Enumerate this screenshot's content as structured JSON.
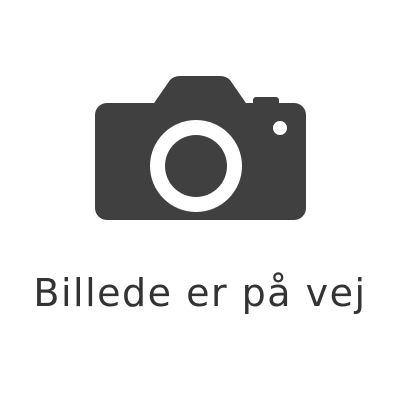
{
  "placeholder": {
    "icon": "camera-icon",
    "caption": "Billede er på vej",
    "colors": {
      "background": "#ffffff",
      "icon": "#404040",
      "text": "#333333"
    }
  }
}
